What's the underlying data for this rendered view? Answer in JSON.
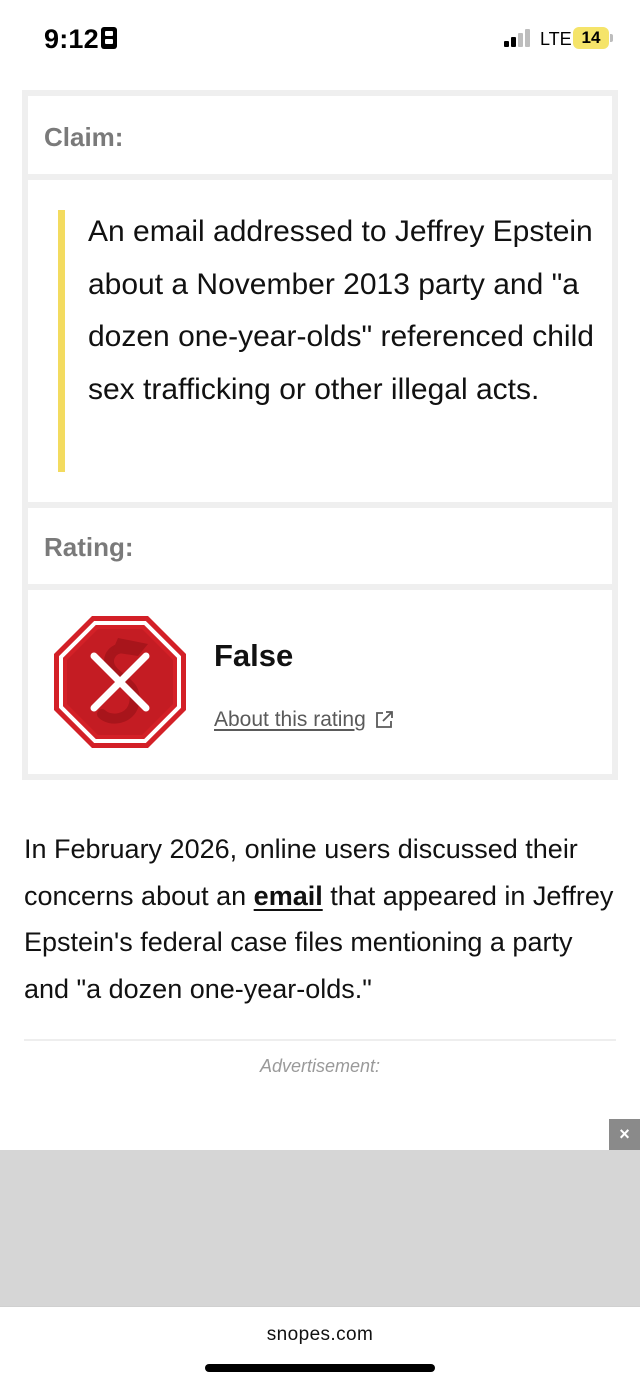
{
  "status_bar": {
    "time": "9:12",
    "network": "LTE",
    "battery": "14",
    "battery_color": "#f5e46a"
  },
  "claim": {
    "label": "Claim:",
    "text": "An email addressed to Jeffrey Epstein about a November 2013 party and \"a dozen one-year-olds\" referenced child sex trafficking or other illegal acts.",
    "accent_color": "#f3db5f"
  },
  "rating": {
    "label": "Rating:",
    "value": "False",
    "badge_icon": "false-rating-stop-sign-icon",
    "badge_color": "#d32027",
    "link_text": "About this rating",
    "link_icon": "external-link-icon"
  },
  "article": {
    "text_before": "In February 2026, online users discussed their concerns about an ",
    "link_text": "email",
    "text_after": " that appeared in Jeffrey Epstein's federal case files mentioning a party and \"a dozen one-year-olds.\""
  },
  "ad": {
    "label": "Advertisement:",
    "close_label": "×"
  },
  "browser": {
    "domain": "snopes.com"
  }
}
